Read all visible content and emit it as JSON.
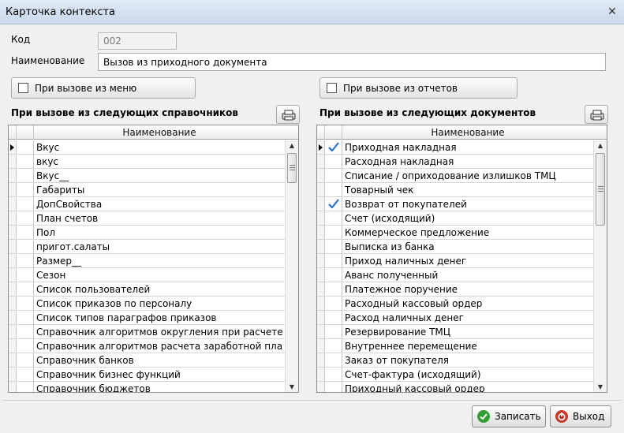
{
  "window": {
    "title": "Карточка контекста",
    "close_glyph": "✕"
  },
  "form": {
    "code_label": "Код",
    "code_value": "002",
    "name_label": "Наименование",
    "name_value": "Вызов из приходного документа"
  },
  "options": {
    "menu_call_label": "При вызове из меню",
    "reports_call_label": "При вызове из отчетов"
  },
  "left_panel": {
    "title": "При вызове из следующих справочников",
    "print_icon": "print-icon",
    "column_header": "Наименование",
    "rows": [
      "Вкус",
      "вкус",
      "Вкус__",
      "Габариты",
      "ДопСвойства",
      "План счетов",
      "Пол",
      "пригот.салаты",
      "Размер__",
      "Сезон",
      "Список пользователей",
      "Список приказов по персоналу",
      "Список типов параграфов приказов",
      "Справочник алгоритмов округления при расчете",
      "Справочник алгоритмов расчета заработной платы",
      "Справочник банков",
      "Справочник бизнес функций",
      "Справочник бюджетов"
    ]
  },
  "right_panel": {
    "title": "При вызове из следующих документов",
    "print_icon": "print-icon",
    "column_header": "Наименование",
    "rows": [
      {
        "name": "Приходная накладная",
        "checked": true
      },
      {
        "name": "Расходная накладная",
        "checked": false
      },
      {
        "name": "Списание / оприходование излишков ТМЦ",
        "checked": false
      },
      {
        "name": "Товарный чек",
        "checked": false
      },
      {
        "name": "Возврат от покупателей",
        "checked": true
      },
      {
        "name": "Счет (исходящий)",
        "checked": false
      },
      {
        "name": "Коммерческое предложение",
        "checked": false
      },
      {
        "name": "Выписка из банка",
        "checked": false
      },
      {
        "name": "Приход наличных денег",
        "checked": false
      },
      {
        "name": "Аванс полученный",
        "checked": false
      },
      {
        "name": "Платежное поручение",
        "checked": false
      },
      {
        "name": "Расходный кассовый ордер",
        "checked": false
      },
      {
        "name": "Расход наличных денег",
        "checked": false
      },
      {
        "name": "Резервирование ТМЦ",
        "checked": false
      },
      {
        "name": "Внутреннее перемещение",
        "checked": false
      },
      {
        "name": "Заказ от покупателя",
        "checked": false
      },
      {
        "name": "Счет-фактура (исходящий)",
        "checked": false
      },
      {
        "name": "Приходный кассовый ордер",
        "checked": false
      }
    ]
  },
  "actions": {
    "save_label": "Записать",
    "exit_label": "Выход",
    "save_color": "#2e9e35",
    "exit_color": "#c93a26"
  },
  "colors": {
    "check_mark": "#2a6fd1"
  }
}
